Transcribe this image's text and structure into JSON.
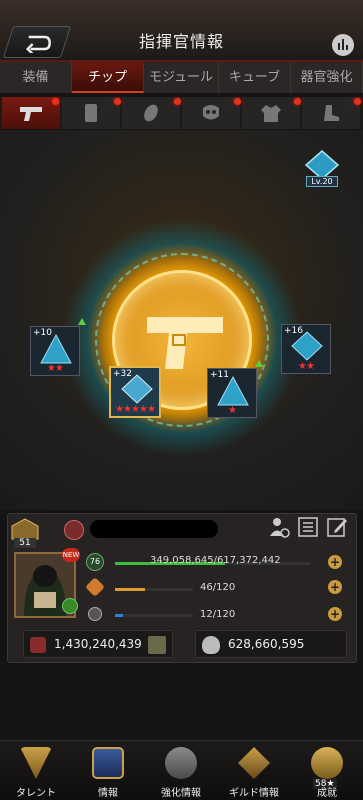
{
  "header": {
    "title": "指揮官情報"
  },
  "tabs": [
    {
      "label": "装備"
    },
    {
      "label": "チップ"
    },
    {
      "label": "モジュール"
    },
    {
      "label": "キューブ"
    },
    {
      "label": "器官強化"
    }
  ],
  "subtabs": [
    "pistol-icon",
    "armor-icon",
    "disc-icon",
    "mask-icon",
    "jacket-icon",
    "boots-icon"
  ],
  "arena": {
    "badge_level": "Lv.20",
    "chips": [
      {
        "level": "+10",
        "stars": "★★",
        "upgrade": true
      },
      {
        "level": "+32",
        "stars": "★★★★★",
        "upgrade": false
      },
      {
        "level": "+11",
        "stars": "★",
        "upgrade": true
      },
      {
        "level": "+16",
        "stars": "★★",
        "upgrade": false
      }
    ]
  },
  "profile": {
    "rank_level": "51",
    "vip_level": "76",
    "new_badge": "NEW",
    "exp": "349,058,645/617,372,442",
    "stamina": "46/120",
    "energy": "12/120",
    "power": "1,430,240,439",
    "kills": "628,660,595",
    "colors": {
      "exp": "#3bbf3b",
      "stamina": "#e09a34",
      "energy": "#2f7fe0"
    },
    "fills": {
      "exp": 0.565,
      "stamina": 0.383,
      "energy": 0.1
    }
  },
  "bottomnav": [
    {
      "label": "タレント"
    },
    {
      "label": "情報"
    },
    {
      "label": "強化情報"
    },
    {
      "label": "ギルド情報"
    },
    {
      "label": "成就",
      "badge": "58★"
    }
  ]
}
